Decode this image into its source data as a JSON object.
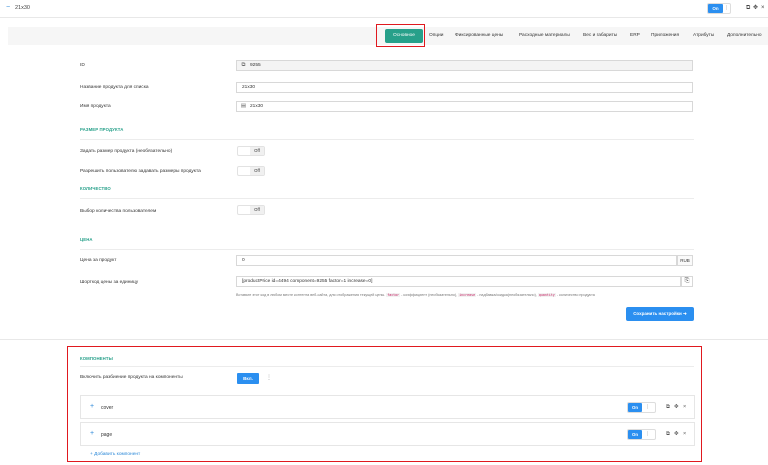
{
  "header": {
    "title": "21x30",
    "toggle_on": "On",
    "toggle_sep": "|",
    "icons": [
      "copy-icon",
      "move-icon",
      "close-icon"
    ]
  },
  "tabs": [
    {
      "label": "Основное",
      "active": true
    },
    {
      "label": "Опции"
    },
    {
      "label": "Фиксированные цены"
    },
    {
      "label": "Расходные материалы"
    },
    {
      "label": "Вес и габариты"
    },
    {
      "label": "ERP"
    },
    {
      "label": "Приложения"
    },
    {
      "label": "Атрибуты"
    },
    {
      "label": "Дополнительно"
    }
  ],
  "form": {
    "id_label": "ID",
    "id_value": "9255",
    "list_name_label": "Название продукта для списка",
    "list_name_value": "21x30",
    "product_name_label": "Имя продукта",
    "product_name_value": "21x30",
    "size_section": "РАЗМЕР ПРОДУКТА",
    "set_size_label": "Задать размер продукта (необязательно)",
    "set_size_state": "Off",
    "allow_user_size_label": "Разрешить пользователю задавать размеры продукта",
    "allow_user_size_state": "Off",
    "qty_section": "КОЛИЧЕСТВО",
    "qty_choice_label": "Выбор количества пользователем",
    "qty_choice_state": "Off",
    "price_section": "ЦЕНА",
    "price_label": "Цена за продукт",
    "price_value": "0",
    "price_unit": "RUB",
    "shortcode_label": "Шорткод цены за единицу",
    "shortcode_value": "[productPrice id=4494 component=9255 factor=1 increase=0]",
    "hint_text_1": "Вставьте этот код в любом месте контента веб-сайта, для отображения текущей цены.",
    "hint_code_1": "factor",
    "hint_text_2": "- коэффициент (необязательно),",
    "hint_code_2": "increase",
    "hint_text_3": "- надбавка/скидка(необязательно),",
    "hint_code_3": "quantity",
    "hint_text_4": "- количество продукта",
    "save_button": "Сохранить настройки"
  },
  "components": {
    "section": "КОМПОНЕНТЫ",
    "enable_label": "Включить разбиение продукта на компоненты",
    "enable_button": "Вкл.",
    "more_glyph": "⋮",
    "items": [
      {
        "name": "cover",
        "toggle": "On"
      },
      {
        "name": "page",
        "toggle": "On"
      }
    ],
    "add_label": "Добавить компонент"
  },
  "colors": {
    "accent": "#27a08a",
    "primary": "#2b8ff0",
    "highlight": "#e0191f"
  }
}
